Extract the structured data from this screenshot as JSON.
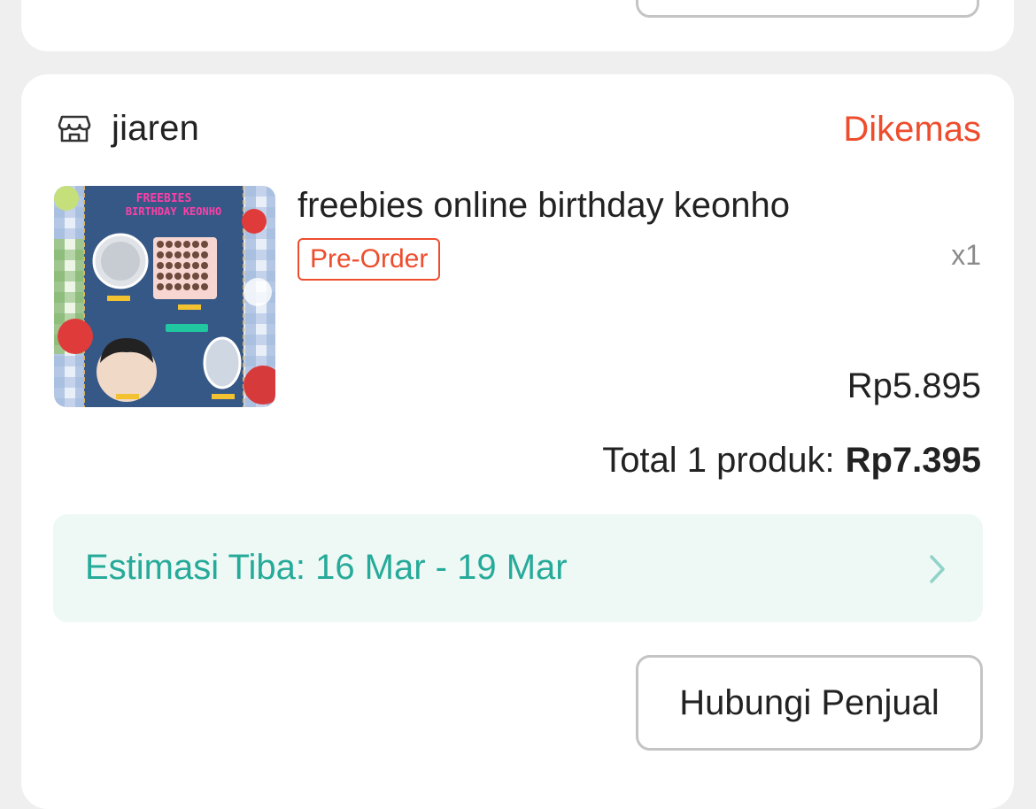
{
  "order": {
    "shop_name": "jiaren",
    "status": "Dikemas",
    "product": {
      "title": "freebies online birthday keonho",
      "badge": "Pre-Order",
      "quantity": "x1",
      "price": "Rp5.895",
      "image_text": "FREEBIES BIRTHDAY KEONHO"
    },
    "total_label": "Total 1 produk:",
    "total_amount": "Rp7.395",
    "eta": "Estimasi Tiba: 16 Mar - 19 Mar",
    "contact_button": "Hubungi Penjual"
  },
  "colors": {
    "accent": "#ee4d2d",
    "eta_text": "#26aa99",
    "eta_bg": "#eef9f6"
  },
  "icons": {
    "shop": "store-icon",
    "eta": "chevron-right-icon"
  }
}
